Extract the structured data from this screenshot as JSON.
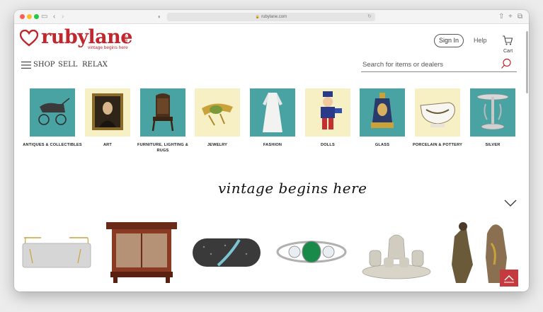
{
  "browser": {
    "url": "rubylane.com"
  },
  "brand": {
    "name": "rubylane",
    "tagline": "vintage begins here",
    "dotcom": ".com",
    "accent_color": "#c0282d"
  },
  "header": {
    "signin_label": "Sign In",
    "help_label": "Help",
    "cart_label": "Cart"
  },
  "nav": {
    "shop": "SHOP",
    "sell": "SELL",
    "relax": "RELAX"
  },
  "search": {
    "placeholder": "Search for items or dealers"
  },
  "categories": [
    {
      "label": "ANTIQUES & COLLECTIBLES",
      "bg": "#4aa3a3",
      "icon": "carriage-icon"
    },
    {
      "label": "ART",
      "bg": "#f7f0c4",
      "icon": "portrait-icon"
    },
    {
      "label": "FURNITURE, LIGHTING & RUGS",
      "bg": "#4aa3a3",
      "icon": "chair-icon"
    },
    {
      "label": "JEWELRY",
      "bg": "#f7f0c4",
      "icon": "brooch-icon"
    },
    {
      "label": "FASHION",
      "bg": "#4aa3a3",
      "icon": "gown-icon"
    },
    {
      "label": "DOLLS",
      "bg": "#f7f0c4",
      "icon": "doll-icon"
    },
    {
      "label": "GLASS",
      "bg": "#4aa3a3",
      "icon": "vase-icon"
    },
    {
      "label": "PORCELAIN & POTTERY",
      "bg": "#f7f0c4",
      "icon": "gravy-boat-icon"
    },
    {
      "label": "SILVER",
      "bg": "#4aa3a3",
      "icon": "epergne-icon"
    }
  ],
  "hero": {
    "tagline": "vintage begins here"
  }
}
